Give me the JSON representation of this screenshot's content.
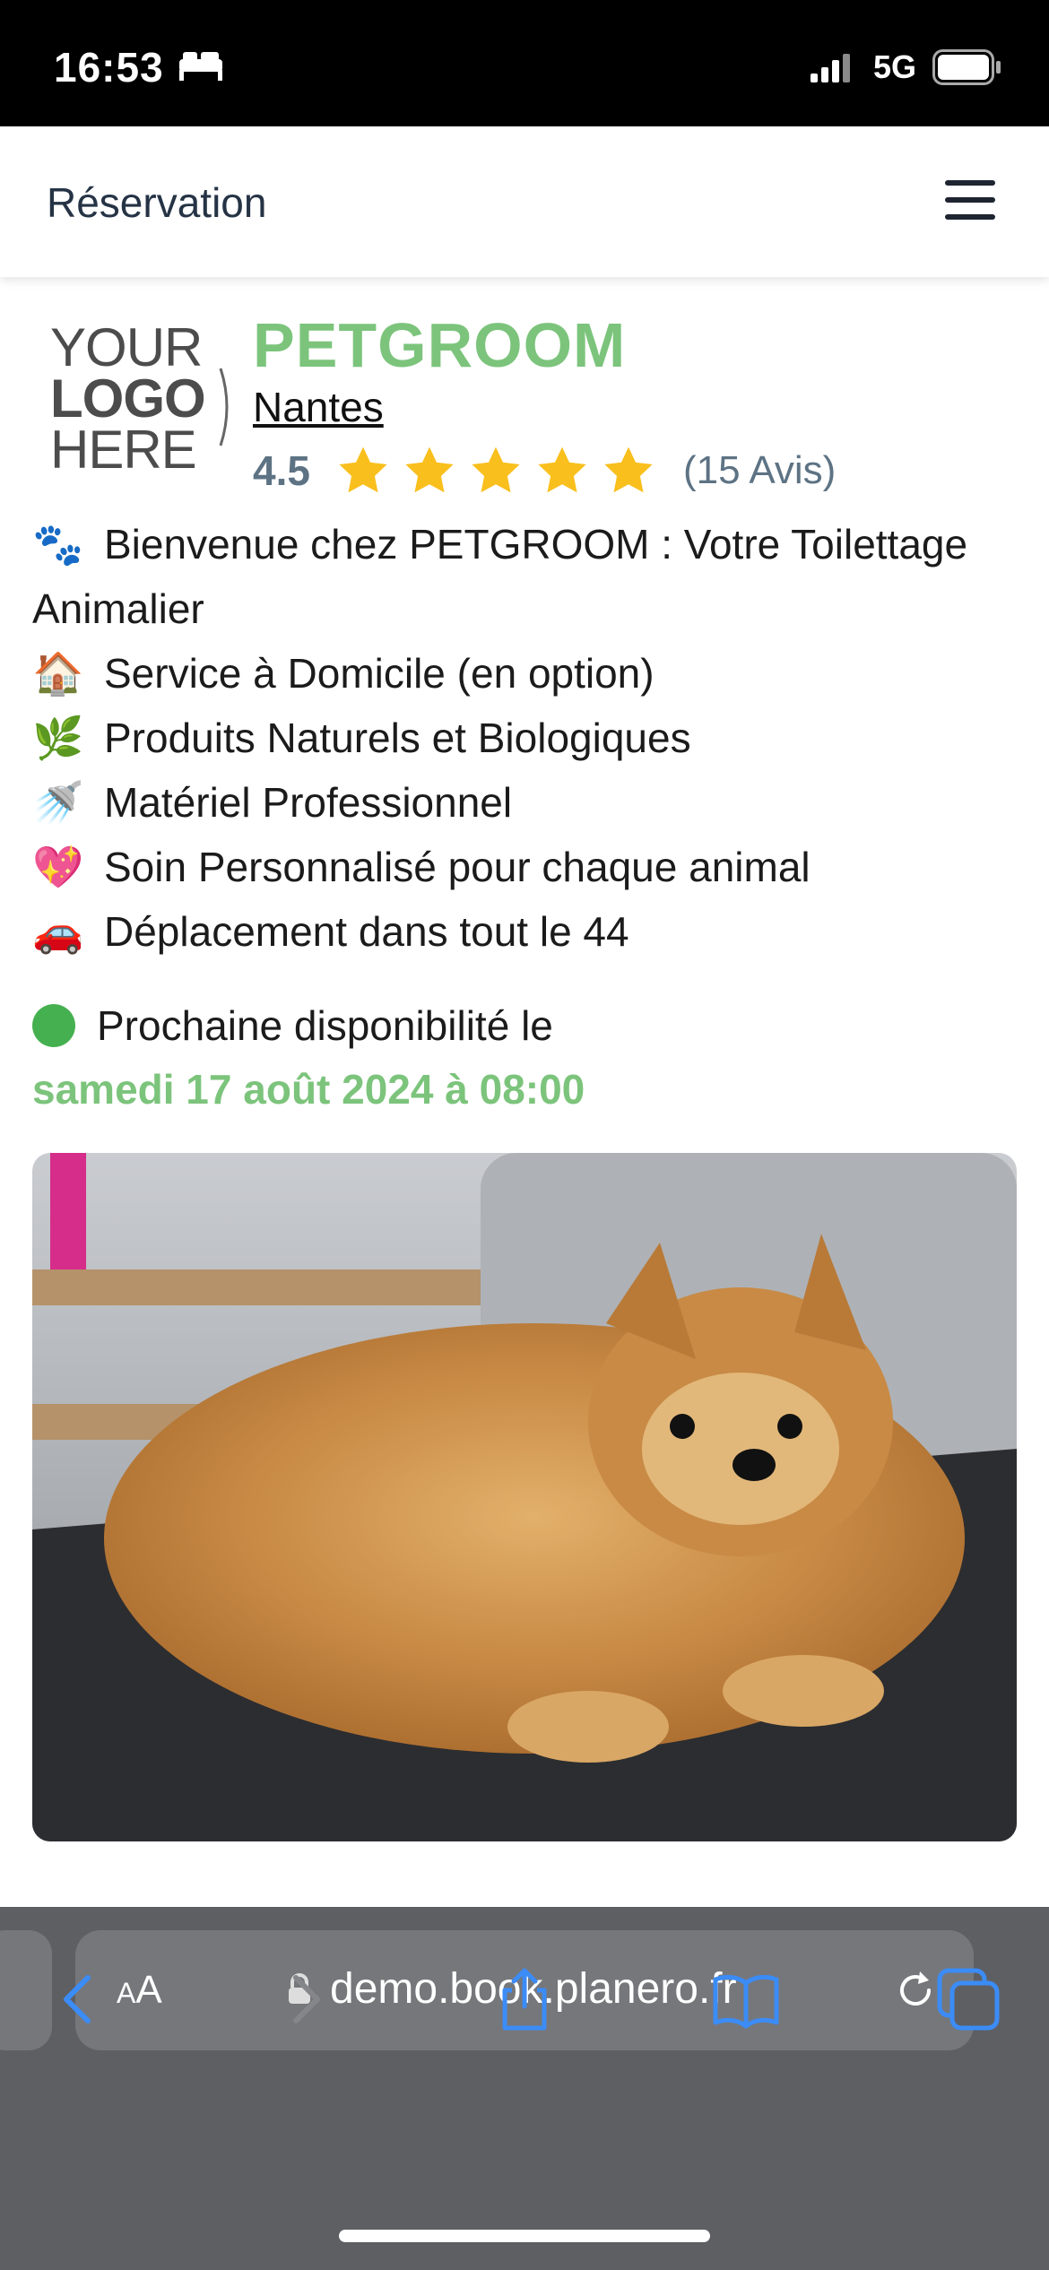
{
  "status_bar": {
    "time": "16:53",
    "network": "5G",
    "icons": [
      "bed-icon",
      "signal-icon",
      "battery-icon"
    ]
  },
  "header": {
    "title": "Réservation",
    "menu_icon": "hamburger-menu-icon"
  },
  "business": {
    "logo_lines": [
      "YOUR",
      "LOGO",
      "HERE"
    ],
    "name": "PETGROOM",
    "city": "Nantes",
    "rating": "4.5",
    "stars": 5,
    "reviews": "(15 Avis)"
  },
  "features": [
    {
      "emoji": "🐾",
      "text": "Bienvenue chez PETGROOM : Votre Toilettage",
      "continuation": "Animalier"
    },
    {
      "emoji": "🏠",
      "text": "Service à Domicile (en option)"
    },
    {
      "emoji": "🌿",
      "text": "Produits Naturels et Biologiques"
    },
    {
      "emoji": "🚿",
      "text": "Matériel Professionnel"
    },
    {
      "emoji": "💖",
      "text": "Soin Personnalisé pour chaque animal"
    },
    {
      "emoji": "🚗",
      "text": "Déplacement dans tout le 44"
    }
  ],
  "availability": {
    "label": "Prochaine disponibilité le",
    "date": "samedi 17 août 2024 à 08:00"
  },
  "browser": {
    "aa_label_small": "A",
    "aa_label_large": "A",
    "url": "demo.book.planero.fr",
    "toolbar": [
      "back-icon",
      "forward-icon",
      "share-icon",
      "bookmarks-icon",
      "tabs-icon"
    ]
  },
  "colors": {
    "brand_green": "#7cc47c",
    "availability_dot": "#45b04f",
    "star_yellow": "#f9bf1c",
    "rating_gray": "#5d7384",
    "ios_blue": "#3b8cf6"
  }
}
